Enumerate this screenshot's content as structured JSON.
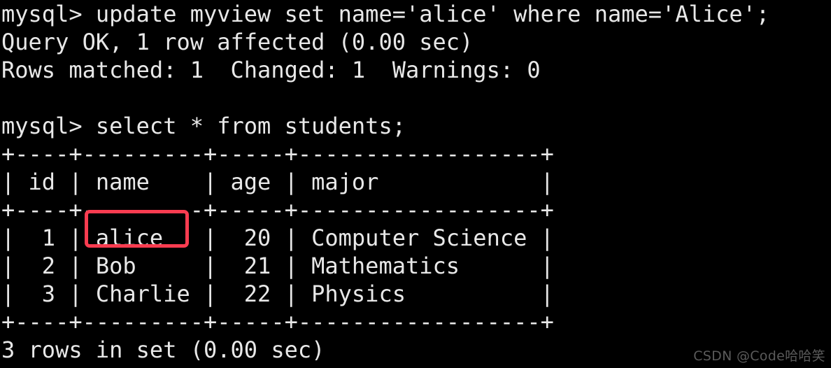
{
  "terminal": {
    "background_color": "#000000",
    "text_color": "#e8e8e8",
    "prompt": "mysql>",
    "lines": [
      {
        "id": "cmd-update",
        "text": "mysql> update myview set name='alice' where name='Alice';"
      },
      {
        "id": "result-query-ok",
        "text": "Query OK, 1 row affected (0.00 sec)"
      },
      {
        "id": "result-rows-matched",
        "text": "Rows matched: 1  Changed: 1  Warnings: 0"
      },
      {
        "id": "blank-1",
        "text": " "
      },
      {
        "id": "cmd-select",
        "text": "mysql> select * from students;"
      },
      {
        "id": "table-rule-top",
        "text": "+----+---------+-----+------------------+"
      },
      {
        "id": "table-header",
        "text": "| id | name    | age | major            |"
      },
      {
        "id": "table-rule-mid",
        "text": "+----+---------+-----+------------------+"
      },
      {
        "id": "table-row-1",
        "text": "|  1 | alice   |  20 | Computer Science |"
      },
      {
        "id": "table-row-2",
        "text": "|  2 | Bob     |  21 | Mathematics      |"
      },
      {
        "id": "table-row-3",
        "text": "|  3 | Charlie |  22 | Physics          |"
      },
      {
        "id": "table-rule-bottom",
        "text": "+----+---------+-----+------------------+"
      },
      {
        "id": "result-row-count",
        "text": "3 rows in set (0.00 sec)"
      }
    ]
  },
  "commands": {
    "update_statement": "update myview set name='alice' where name='Alice';",
    "select_statement": "select * from students;"
  },
  "query_results": {
    "update_status": "Query OK, 1 row affected (0.00 sec)",
    "update_detail": "Rows matched: 1  Changed: 1  Warnings: 0",
    "rows_matched": "1",
    "changed": "1",
    "warnings": "0",
    "affected_rows": "1",
    "update_time": "0.00 sec",
    "select_status": "3 rows in set (0.00 sec)",
    "select_row_count": "3",
    "select_time": "0.00 sec"
  },
  "table": {
    "name": "students",
    "columns": [
      "id",
      "name",
      "age",
      "major"
    ],
    "rows": [
      {
        "id": "1",
        "name": "alice",
        "age": "20",
        "major": "Computer Science"
      },
      {
        "id": "2",
        "name": "Bob",
        "age": "21",
        "major": "Mathematics"
      },
      {
        "id": "3",
        "name": "Charlie",
        "age": "22",
        "major": "Physics"
      }
    ]
  },
  "annotation": {
    "highlight_target": "alice",
    "highlight_color": "#fa3c50",
    "description": "red rectangle around the updated name value"
  },
  "watermark": {
    "text": "CSDN @Code哈哈笑",
    "color": "#5a5a5a"
  }
}
